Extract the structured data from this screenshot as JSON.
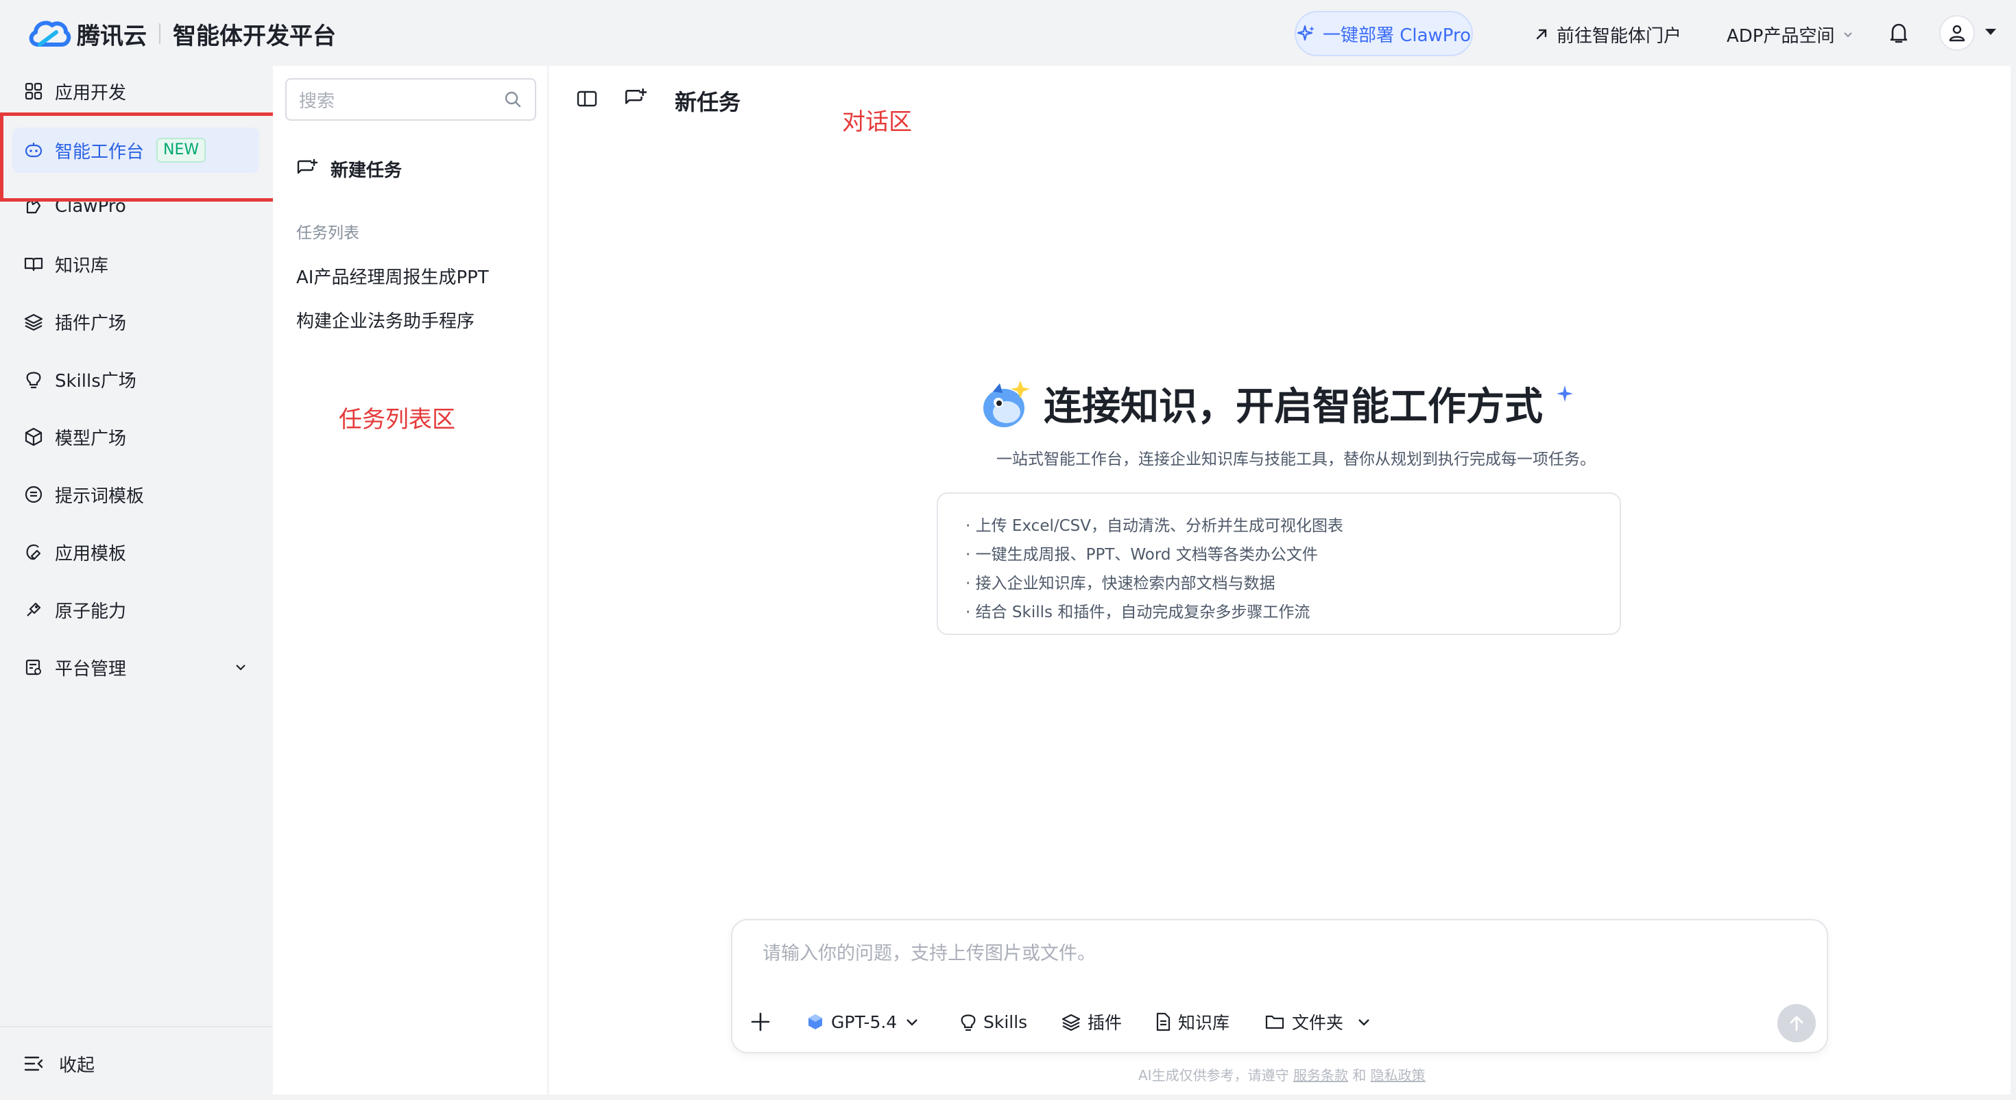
{
  "header": {
    "brand_name": "腾讯云",
    "platform_name": "智能体开发平台",
    "deploy_button": "一键部署 ClawPro",
    "portal_link": "前往智能体门户",
    "space_dropdown": "ADP产品空间"
  },
  "sidebar": {
    "items": [
      {
        "label": "应用开发",
        "icon": "grid-icon"
      },
      {
        "label": "智能工作台",
        "icon": "robot-icon",
        "badge": "NEW",
        "active": true
      },
      {
        "label": "ClawPro",
        "icon": "claw-icon"
      },
      {
        "label": "知识库",
        "icon": "book-icon"
      },
      {
        "label": "插件广场",
        "icon": "layers-icon"
      },
      {
        "label": "Skills广场",
        "icon": "bulb-icon"
      },
      {
        "label": "模型广场",
        "icon": "cube-icon"
      },
      {
        "label": "提示词模板",
        "icon": "prompt-icon"
      },
      {
        "label": "应用模板",
        "icon": "template-icon"
      },
      {
        "label": "原子能力",
        "icon": "atom-icon"
      },
      {
        "label": "平台管理",
        "icon": "admin-icon"
      }
    ],
    "collapse_label": "收起"
  },
  "task_panel": {
    "search_placeholder": "搜索",
    "new_task_label": "新建任务",
    "list_label": "任务列表",
    "tasks": [
      "AI产品经理周报生成PPT",
      "构建企业法务助手程序"
    ],
    "annotation": "任务列表区"
  },
  "main": {
    "title": "新任务",
    "annotation": "对话区",
    "hero_title": "连接知识，开启智能工作方式",
    "hero_subtitle": "一站式智能工作台，连接企业知识库与技能工具，替你从规划到执行完成每一项任务。",
    "features": [
      "· 上传 Excel/CSV，自动清洗、分析并生成可视化图表",
      "· 一键生成周报、PPT、Word 文档等各类办公文件",
      "· 接入企业知识库，快速检索内部文档与数据",
      "· 结合 Skills 和插件，自动完成复杂多步骤工作流"
    ]
  },
  "composer": {
    "placeholder": "请输入你的问题，支持上传图片或文件。",
    "model": "GPT-5.4",
    "skills": "Skills",
    "plugins": "插件",
    "knowledge": "知识库",
    "folder": "文件夹",
    "disclaimer_prefix": "AI生成仅供参考，请遵守",
    "terms": "服务条款",
    "and": "和",
    "privacy": "隐私政策"
  },
  "colors": {
    "accent": "#2b62e4",
    "annotation_red": "#e53a3a",
    "badge_green": "#00a870"
  }
}
